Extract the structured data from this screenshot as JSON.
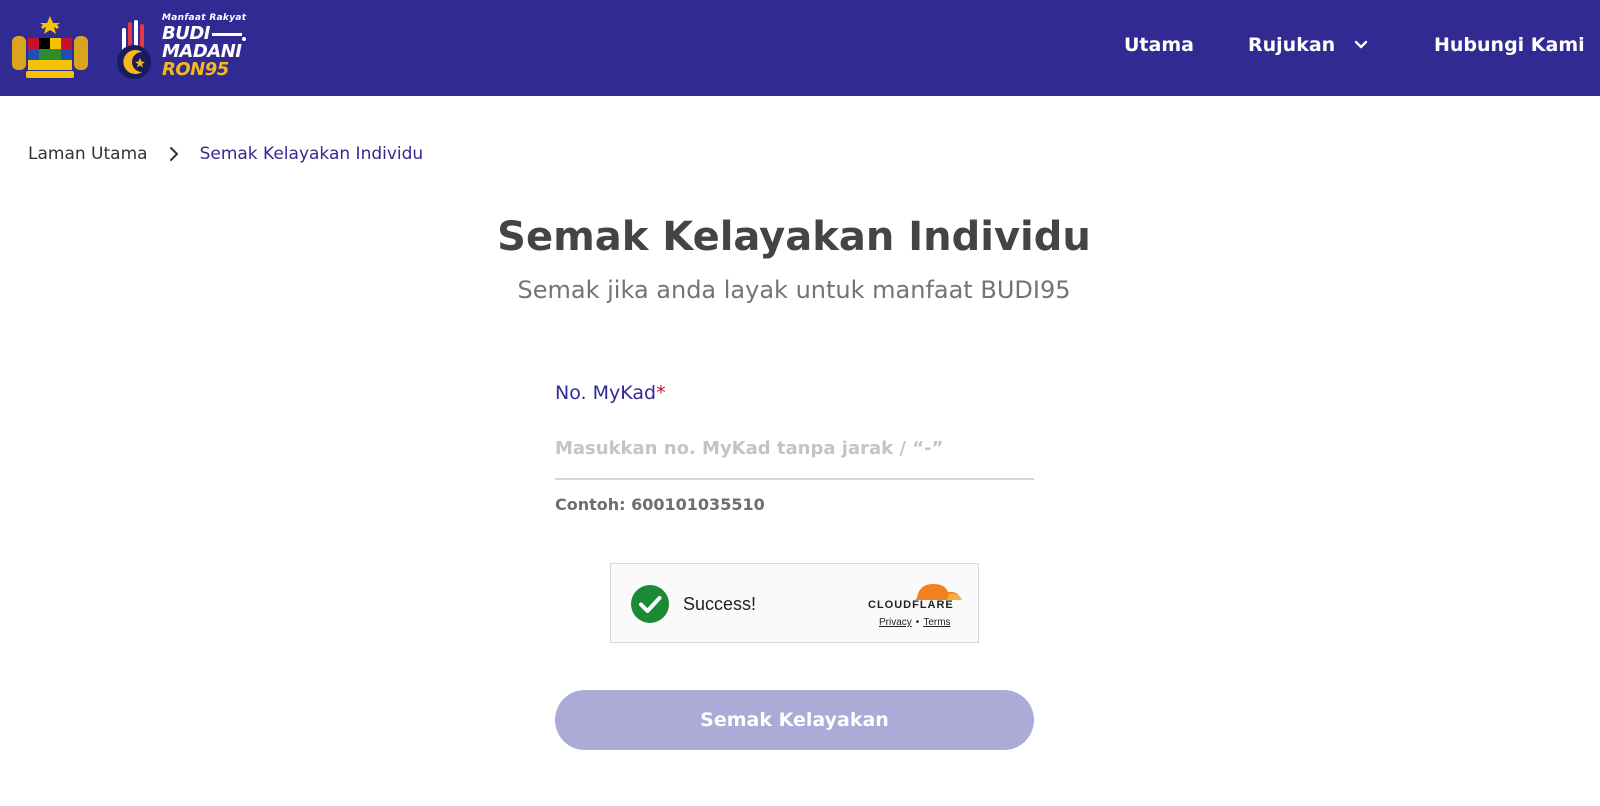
{
  "header": {
    "brand": {
      "tagline": "Manfaat Rakyat",
      "line1": "BUDI",
      "line2": "MADANI",
      "line3": "RON95"
    },
    "nav": [
      {
        "label": "Utama"
      },
      {
        "label": "Rujukan"
      },
      {
        "label": "Hubungi Kami"
      }
    ]
  },
  "breadcrumb": {
    "home": "Laman Utama",
    "current": "Semak Kelayakan Individu"
  },
  "page": {
    "title": "Semak Kelayakan Individu",
    "subtitle": "Semak jika anda layak untuk manfaat BUDI95"
  },
  "form": {
    "mykad_label": "No. MyKad",
    "required_mark": "*",
    "mykad_value": "",
    "mykad_placeholder": "Masukkan no. MyKad tanpa jarak / “-”",
    "hint": "Contoh: 600101035510",
    "submit_label": "Semak Kelayakan"
  },
  "captcha": {
    "status": "Success!",
    "provider": "CLOUDFLARE",
    "privacy": "Privacy",
    "separator": "•",
    "terms": "Terms"
  },
  "colors": {
    "header_bg": "#322a93",
    "accent": "#322a93",
    "button_disabled": "#acaad6",
    "success_green": "#1a8a35",
    "cloudflare_orange": "#f38020",
    "gold": "#f5b81c"
  }
}
